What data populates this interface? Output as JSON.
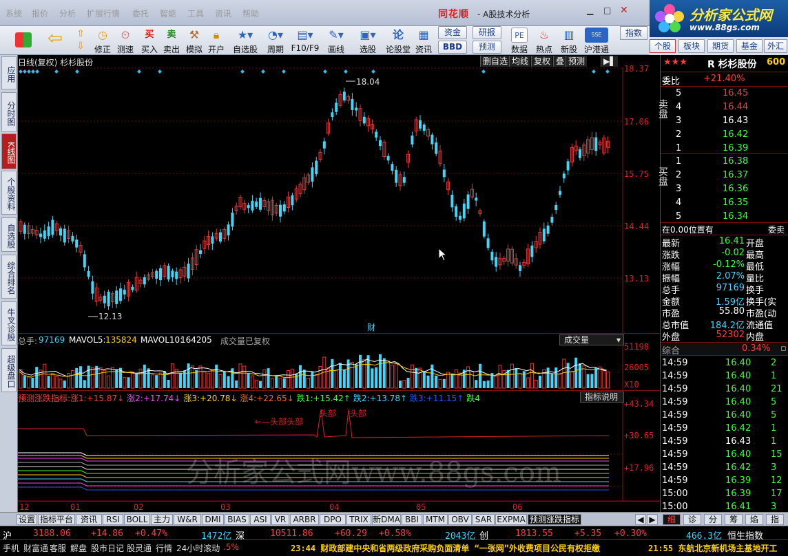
{
  "menu": [
    "系统",
    "报价",
    "分析",
    "扩展行情",
    "委托",
    "智能",
    "工具",
    "资讯",
    "帮助"
  ],
  "app": {
    "logo": "同花顺",
    "title": "- A股技术分析"
  },
  "ad": {
    "title": "分析家公式网",
    "url": "www.88gs.com"
  },
  "toolbar": {
    "buttons": [
      "修正",
      "测速",
      "买入",
      "卖出",
      "模拟",
      "开户",
      "自选股",
      "周期",
      "F10/F9",
      "画线",
      "选股",
      "论股堂",
      "资讯",
      "数据",
      "热点",
      "新股",
      "沪港通"
    ],
    "small": [
      "资金",
      "研报",
      "BBD",
      "预测"
    ],
    "right": [
      "指数",
      "个股",
      "板块",
      "期货",
      "基金",
      "外汇"
    ]
  },
  "sidebar": [
    "应用",
    "分时图",
    "K线图",
    "个股资料",
    "自选股",
    "综合排名",
    "牛叉诊股",
    "超级盘口"
  ],
  "kchart": {
    "title": "日线(复权) 杉杉股份",
    "buttons": [
      "删自选",
      "均线",
      "复权",
      "叠",
      "预测"
    ],
    "yaxis": [
      "18.37",
      "17.06",
      "15.75",
      "14.44",
      "13.13"
    ],
    "high_label": "18.04",
    "low_label": "12.13",
    "fin_mark": "财",
    "xaxis": [
      "12",
      "01",
      "02",
      "03",
      "04",
      "05",
      "06"
    ]
  },
  "volume": {
    "total_label": "总手:",
    "total": "97169",
    "ma5_label": "MAVOL5:",
    "ma5": "135824",
    "ma10_label": "MAVOL10:",
    "ma10": "164205",
    "note": "成交量已复权",
    "dropdown": "成交量",
    "yaxis": [
      "51198",
      "26005",
      "X10"
    ]
  },
  "indicator": {
    "name": "预测涨跌指标:",
    "items": [
      {
        "label": "涨1:",
        "value": "+15.87"
      },
      {
        "label": "涨2:",
        "value": "+17.74"
      },
      {
        "label": "涨3:",
        "value": "+20.78"
      },
      {
        "label": "涨4:",
        "value": "+22.65"
      },
      {
        "label": "跌1:",
        "value": "+15.42"
      },
      {
        "label": "跌2:",
        "value": "+13.78"
      },
      {
        "label": "跌3:",
        "value": "+11.15"
      },
      {
        "label": "跌4",
        "value": ""
      }
    ],
    "dropdown": "指标说明",
    "yaxis": [
      "+43.34",
      "+30.65",
      "+17.96"
    ],
    "annotations": [
      "头部",
      "头部",
      "头部",
      "头部"
    ]
  },
  "watermark": "分析家公式网www.88gs.com",
  "bottom_tabs": [
    "设置",
    "指标平台",
    "资讯",
    "RSI",
    "BOLL",
    "主力",
    "W&R",
    "DMI",
    "BIAS",
    "ASI",
    "VR",
    "ARBR",
    "DPO",
    "TRIX",
    "新DMA",
    "BBI",
    "MTM",
    "OBV",
    "SAR",
    "EXPMA",
    "预测涨跌指标"
  ],
  "right_mini_tabs": [
    "细",
    "诊",
    "分",
    "筹",
    "焰",
    "指"
  ],
  "panel": {
    "stars": "★★★",
    "name": "R 杉杉股份",
    "code": "600",
    "weibi_label": "委比",
    "weibi": "+21.40%",
    "sell": [
      {
        "n": "5",
        "p": "16.45"
      },
      {
        "n": "4",
        "p": "16.44"
      },
      {
        "n": "3",
        "p": "16.43"
      },
      {
        "n": "2",
        "p": "16.42"
      },
      {
        "n": "1",
        "p": "16.39"
      }
    ],
    "buy": [
      {
        "n": "1",
        "p": "16.38"
      },
      {
        "n": "2",
        "p": "16.37"
      },
      {
        "n": "3",
        "p": "16.36"
      },
      {
        "n": "4",
        "p": "16.35"
      },
      {
        "n": "5",
        "p": "16.34"
      }
    ],
    "sell_label": "卖盘",
    "buy_label": "买盘",
    "pos_text": "在0.00位置有",
    "pos_right": "委卖",
    "stats": [
      {
        "l": "最新",
        "v": "16.41",
        "c": "green",
        "r": "开盘"
      },
      {
        "l": "涨跌",
        "v": "-0.02",
        "c": "green",
        "r": "最高"
      },
      {
        "l": "涨幅",
        "v": "-0.12%",
        "c": "green",
        "r": "最低"
      },
      {
        "l": "振幅",
        "v": "2.07%",
        "c": "cyan",
        "r": "量比"
      },
      {
        "l": "总手",
        "v": "97169",
        "c": "cyan",
        "r": "换手"
      },
      {
        "l": "金额",
        "v": "1.59亿",
        "c": "cyan",
        "r": "换手(实"
      },
      {
        "l": "市盈",
        "v": "55.80",
        "c": "white",
        "r": "市盈(动"
      },
      {
        "l": "总市值",
        "v": "184.2亿",
        "c": "cyan",
        "r": "流通值"
      },
      {
        "l": "外盘",
        "v": "52302",
        "c": "red",
        "r": "内盘"
      }
    ],
    "summary_label": "综合",
    "summary_value": "0.34%",
    "ticks": [
      {
        "t": "14:59",
        "p": "16.40",
        "pc": "green",
        "v": "2"
      },
      {
        "t": "14:59",
        "p": "16.40",
        "pc": "green",
        "v": "1"
      },
      {
        "t": "14:59",
        "p": "16.40",
        "pc": "green",
        "v": "21"
      },
      {
        "t": "14:59",
        "p": "16.40",
        "pc": "green",
        "v": "5"
      },
      {
        "t": "14:59",
        "p": "16.40",
        "pc": "green",
        "v": "5"
      },
      {
        "t": "14:59",
        "p": "16.42",
        "pc": "green",
        "v": "1"
      },
      {
        "t": "14:59",
        "p": "16.43",
        "pc": "white",
        "v": "1"
      },
      {
        "t": "14:59",
        "p": "16.40",
        "pc": "green",
        "v": "15"
      },
      {
        "t": "14:59",
        "p": "16.42",
        "pc": "green",
        "v": "3"
      },
      {
        "t": "14:59",
        "p": "16.39",
        "pc": "green",
        "v": "12"
      },
      {
        "t": "15:00",
        "p": "16.39",
        "pc": "green",
        "v": "17"
      },
      {
        "t": "15:00",
        "p": "16.41",
        "pc": "green",
        "v": "3"
      }
    ]
  },
  "status1": {
    "sh_label": "沪",
    "sh": "3188.06",
    "sh_ch": "+14.86",
    "sh_pct": "+0.47%",
    "sh_amt": "1472亿",
    "sz_label": "深",
    "sz": "10511.86",
    "sz_ch": "+60.29",
    "sz_pct": "+0.58%",
    "sz_amt": "2043亿",
    "cy_label": "创",
    "cy": "1813.55",
    "cy_ch": "+5.35",
    "cy_pct": "+0.30%",
    "hk_amt": "466.3亿",
    "hk_label": "恒生指数"
  },
  "status2": {
    "items": [
      "手机",
      "财富通",
      "客服",
      "解盘",
      "股市日记",
      "股灵通",
      "行情",
      "24小时滚动",
      ".5%"
    ],
    "news1": "23:44 财政部建中央和省两级政府采购负面清单 “一张网”外收费项目公民有权拒缴",
    "news2": "21:55 东航北京新机场主基地开工"
  }
}
